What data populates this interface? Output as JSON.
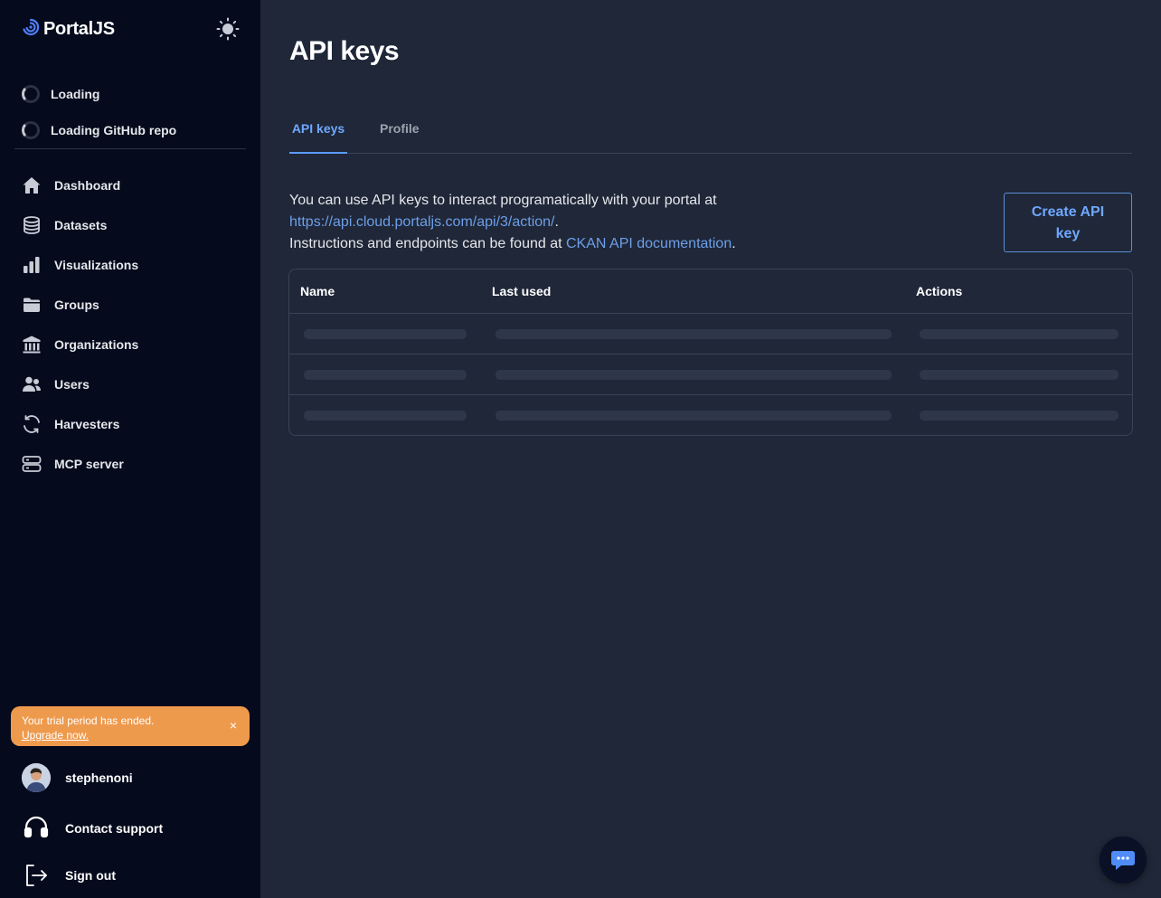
{
  "brand": {
    "name": "PortalJS"
  },
  "loading": [
    {
      "label": "Loading"
    },
    {
      "label": "Loading GitHub repo"
    }
  ],
  "nav": [
    {
      "label": "Dashboard",
      "icon": "home-icon"
    },
    {
      "label": "Datasets",
      "icon": "database-icon"
    },
    {
      "label": "Visualizations",
      "icon": "bar-chart-icon"
    },
    {
      "label": "Groups",
      "icon": "folder-icon"
    },
    {
      "label": "Organizations",
      "icon": "building-icon"
    },
    {
      "label": "Users",
      "icon": "users-icon"
    },
    {
      "label": "Harvesters",
      "icon": "refresh-icon"
    },
    {
      "label": "MCP server",
      "icon": "server-icon"
    }
  ],
  "trial": {
    "message": "Your trial period has ended.",
    "link": "Upgrade now.",
    "close": "×"
  },
  "user": {
    "name": "stephenoni"
  },
  "support": {
    "label": "Contact support"
  },
  "signout": {
    "label": "Sign out"
  },
  "page": {
    "title": "API keys",
    "tabs": [
      {
        "label": "API keys",
        "active": true
      },
      {
        "label": "Profile",
        "active": false
      }
    ],
    "intro": {
      "line1": "You can use API keys to interact programatically with your portal at",
      "url": "https://api.cloud.portaljs.com/api/3/action/",
      "after_url": ".",
      "line2": "Instructions and endpoints can be found at ",
      "doc_link": "CKAN API documentation",
      "after_doc": "."
    },
    "create_button": "Create API key"
  },
  "table": {
    "columns": [
      "Name",
      "Last used",
      "Actions"
    ],
    "row_count": 3
  },
  "colors": {
    "sidebar_bg": "#050a1c",
    "main_bg": "#1f2738",
    "accent": "#6fa8ff",
    "trial_bg": "#ee9a4d"
  }
}
